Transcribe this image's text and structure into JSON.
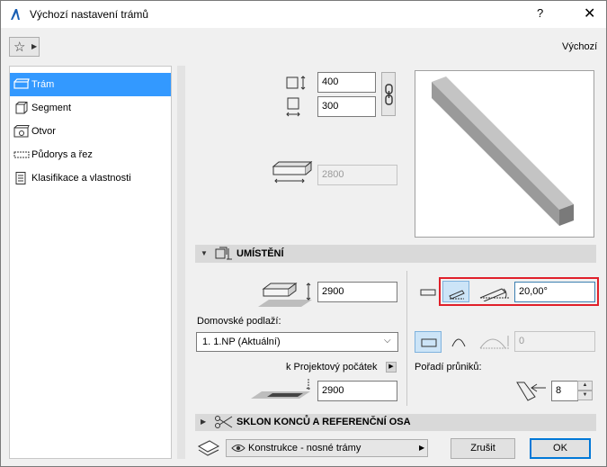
{
  "window": {
    "title": "Výchozí nastavení trámů",
    "help": "?",
    "close": "✕"
  },
  "toolbar": {
    "favorites_icon": "star-icon",
    "defaults_label": "Výchozí"
  },
  "sidebar": {
    "items": [
      {
        "label": "Trám",
        "icon": "beam-icon",
        "active": true
      },
      {
        "label": "Segment",
        "icon": "segment-icon",
        "active": false
      },
      {
        "label": "Otvor",
        "icon": "opening-icon",
        "active": false
      },
      {
        "label": "Půdorys a řez",
        "icon": "floorplan-section-icon",
        "active": false
      },
      {
        "label": "Klasifikace a vlastnosti",
        "icon": "classification-icon",
        "active": false
      }
    ]
  },
  "geometry": {
    "width": "400",
    "height": "300",
    "length": "2800"
  },
  "placement": {
    "section_title": "UMÍSTĚNÍ",
    "reference_height": "2900",
    "home_story_label": "Domovské podlaží:",
    "home_story_value": "1. 1.NP (Aktuální)",
    "project_zero_label": "k Projektový počátek",
    "project_zero_value": "2900",
    "slope_angle": "20,00°",
    "arc_value": "0",
    "intersection_priority_label": "Pořadí průniků:",
    "intersection_priority_value": "8"
  },
  "sections": {
    "collapsed_title": "SKLON KONCŮ A REFERENČNÍ OSA"
  },
  "footer": {
    "layer_value": "Konstrukce - nosné trámy",
    "cancel_label": "Zrušit",
    "ok_label": "OK"
  },
  "colors": {
    "accent": "#3399ff",
    "highlight": "#e0202a",
    "selected_toggle": "#cce4f7"
  }
}
